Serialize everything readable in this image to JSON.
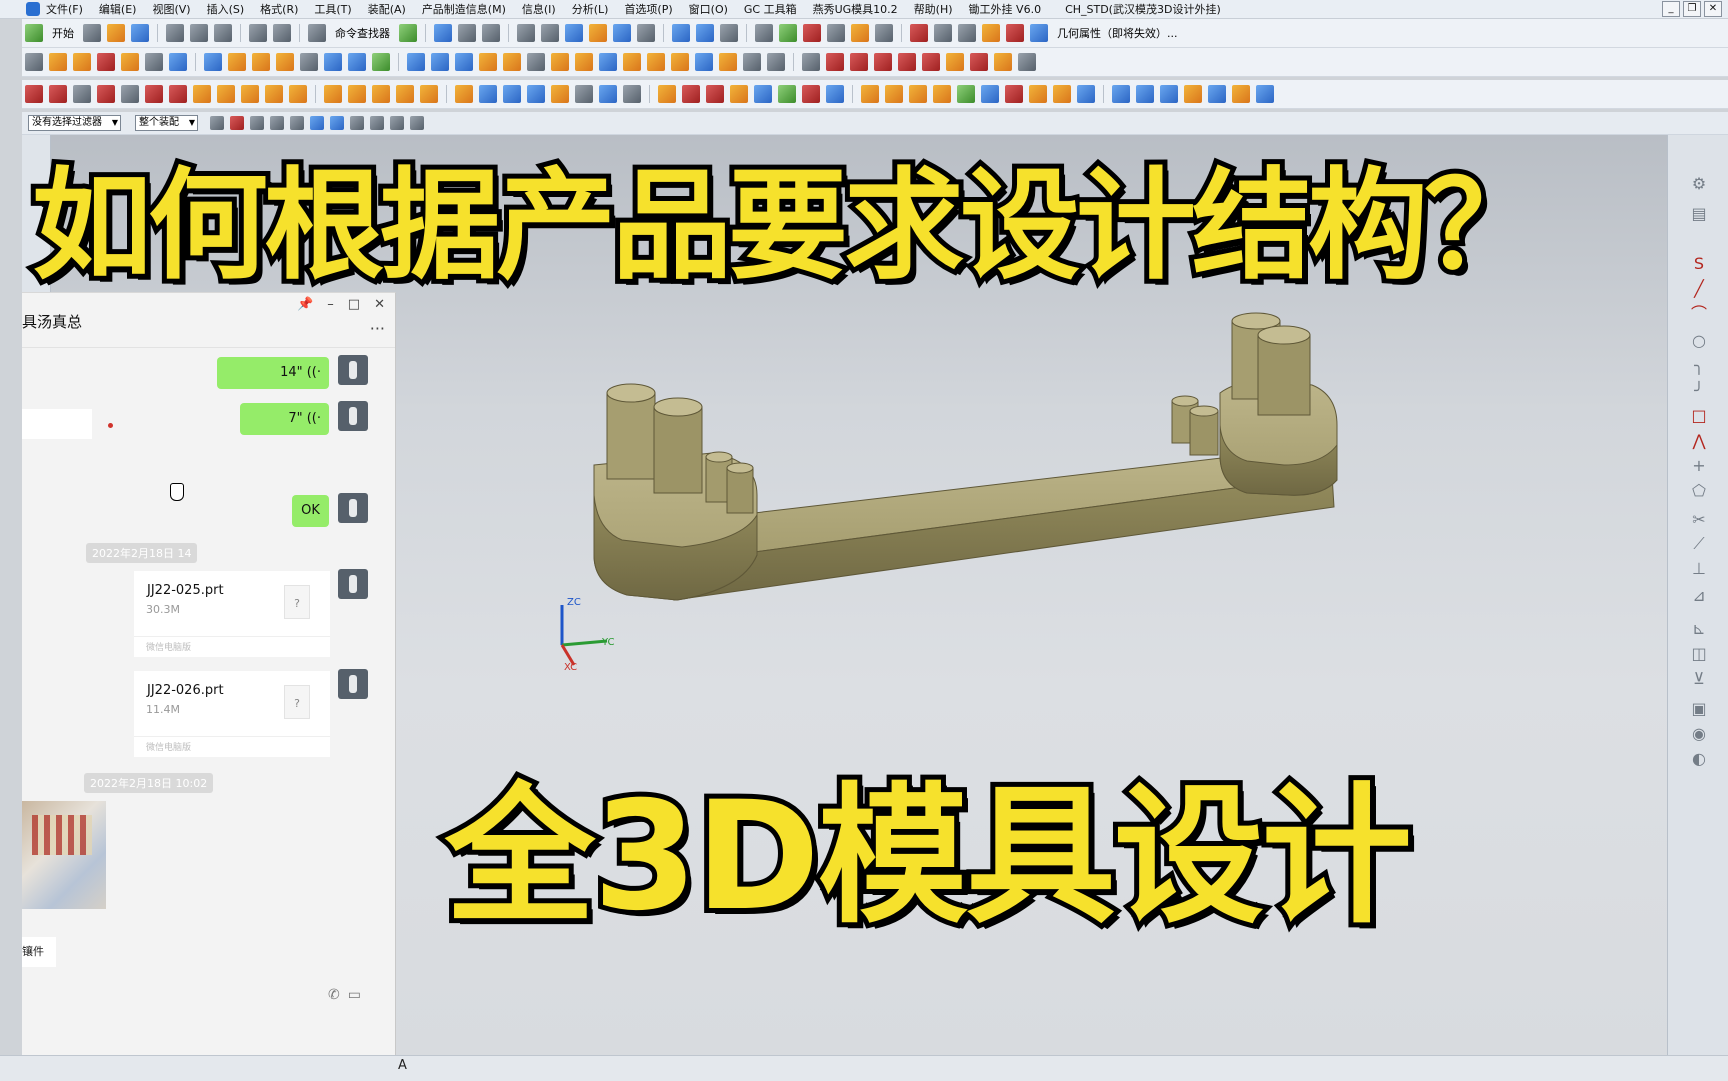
{
  "menubar": {
    "items": [
      "文件(F)",
      "编辑(E)",
      "视图(V)",
      "插入(S)",
      "格式(R)",
      "工具(T)",
      "装配(A)",
      "产品制造信息(M)",
      "信息(I)",
      "分析(L)",
      "首选项(P)",
      "窗口(O)",
      "GC 工具箱",
      "燕秀UG模具10.2",
      "帮助(H)",
      "锄工外挂 V6.0"
    ],
    "window_title": "CH_STD(武汉模茂3D设计外挂)"
  },
  "toolbar": {
    "start_label": "开始",
    "command_finder": "命令查找器",
    "geom_props": "几何属性（即将失效）..."
  },
  "filters": {
    "selection_filter": "没有选择过滤器",
    "assembly_scope": "整个装配"
  },
  "overlay": {
    "headline_top": "如何根据产品要求设计结构？",
    "headline_bottom": "全3D模具设计"
  },
  "viewport_axes": {
    "z": "ZC",
    "y": "YC",
    "x": "XC"
  },
  "chat": {
    "title": "具汤真总",
    "more": "···",
    "voice1": "14\" ((·",
    "voice2": "7\" ((·",
    "ok": "OK",
    "timestamp1": "2022年2月18日 14",
    "timestamp2": "2022年2月18日 10:02",
    "files": [
      {
        "name": "JJ22-025.prt",
        "size": "30.3M",
        "source": "微信电脑版"
      },
      {
        "name": "JJ22-026.prt",
        "size": "11.4M",
        "source": "微信电脑版"
      }
    ],
    "chip": "镶件",
    "unknown_icon": "?"
  },
  "status": {
    "text": "A"
  },
  "colors": {
    "headline_fill": "#f6e12c",
    "part": "#9c9466",
    "chat_green": "#95ec69"
  }
}
